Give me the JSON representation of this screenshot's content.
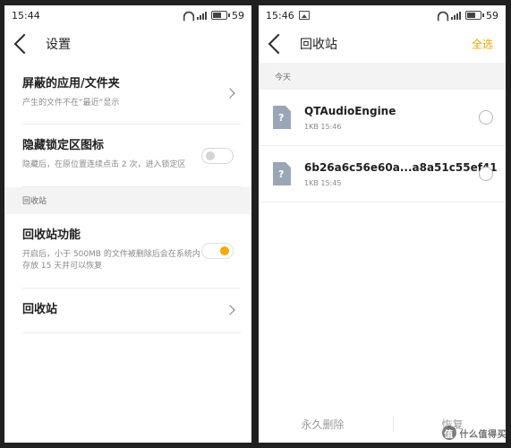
{
  "left": {
    "time": "15:44",
    "battery": "59",
    "title": "设置",
    "rows": [
      {
        "title": "屏蔽的应用/文件夹",
        "desc": "产生的文件不在“最近”显示"
      },
      {
        "title": "隐藏锁定区图标",
        "desc": "隐藏后，在原位置连续点击 2 次，进入锁定区"
      }
    ],
    "section": "回收站",
    "recycle_feature": {
      "title": "回收站功能",
      "desc": "开启后，小于 500MB 的文件被删除后会在系统内存放 15 天并可以恢复"
    },
    "recycle_bin": {
      "title": "回收站"
    }
  },
  "right": {
    "time": "15:46",
    "battery": "59",
    "title": "回收站",
    "select_all": "全选",
    "date_label": "今天",
    "files": [
      {
        "name": "QTAudioEngine",
        "meta": "1KB  15:46"
      },
      {
        "name": "6b26a6c56e60a...a8a51c55ef41",
        "meta": "1KB  15:45"
      }
    ],
    "bottom": {
      "delete": "永久删除",
      "restore": "恢复"
    }
  },
  "watermark": {
    "badge": "值",
    "text": "什么值得买"
  },
  "colors": {
    "accent": "#f3a900",
    "file_icon": "#9aa6b5",
    "background": "#202020"
  }
}
